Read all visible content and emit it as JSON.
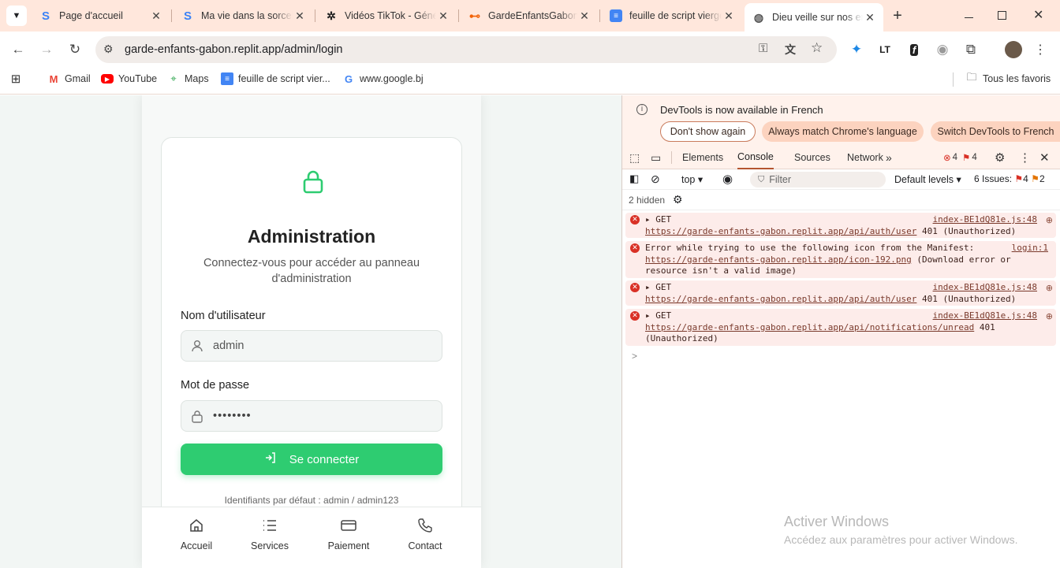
{
  "browser": {
    "tabs": [
      {
        "title": "Page d'accueil",
        "icon": "replit-icon"
      },
      {
        "title": "Ma vie dans la sorcellerie",
        "icon": "replit-icon"
      },
      {
        "title": "Vidéos TikTok - Générateur",
        "icon": "openai-icon"
      },
      {
        "title": "GardeEnfantsGabon",
        "icon": "replit-orange-icon"
      },
      {
        "title": "feuille de script vierge",
        "icon": "google-docs-icon"
      },
      {
        "title": "Dieu veille sur nos enfants",
        "icon": "globe-icon",
        "active": true
      }
    ],
    "new_tab": "+",
    "url": "garde-enfants-gabon.replit.app/admin/login",
    "bookmarks": [
      {
        "label": "Gmail",
        "icon": "gmail-icon"
      },
      {
        "label": "YouTube",
        "icon": "youtube-icon"
      },
      {
        "label": "Maps",
        "icon": "maps-icon"
      },
      {
        "label": "feuille de script vier...",
        "icon": "google-docs-icon"
      },
      {
        "label": "www.google.bj",
        "icon": "google-icon"
      }
    ],
    "all_bookmarks": "Tous les favoris"
  },
  "login": {
    "title": "Administration",
    "subtitle": "Connectez-vous pour accéder au panneau d'administration",
    "username_label": "Nom d'utilisateur",
    "username_value": "admin",
    "password_label": "Mot de passe",
    "password_value": "••••••••",
    "submit": "Se connecter",
    "hint": "Identifiants par défaut : admin / admin123"
  },
  "bottom_nav": [
    {
      "label": "Accueil",
      "icon": "home-icon"
    },
    {
      "label": "Services",
      "icon": "list-icon"
    },
    {
      "label": "Paiement",
      "icon": "credit-card-icon"
    },
    {
      "label": "Contact",
      "icon": "phone-icon"
    }
  ],
  "devtools": {
    "info_text": "DevTools is now available in French",
    "btn_dont_show": "Don't show again",
    "btn_match": "Always match Chrome's language",
    "btn_switch": "Switch DevTools to French",
    "tabs": [
      "Elements",
      "Console",
      "Sources",
      "Network"
    ],
    "active_tab": "Console",
    "error_count": "4",
    "warning_count": "4",
    "context": "top",
    "filter_placeholder": "Filter",
    "levels": "Default levels",
    "issues_label": "6 Issues:",
    "issues_errors": "4",
    "issues_warnings": "2",
    "hidden": "2 hidden",
    "messages": [
      {
        "type": "GET",
        "source": "index-BE1dQ81e.js:48",
        "url": "https://garde-enfants-gabon.replit.app/api/auth/user",
        "status": "401 (Unauthorized)"
      },
      {
        "type": "Error while trying to use the following icon from the Manifest:",
        "source": "login:1",
        "url": "https://garde-enfants-gabon.replit.app/icon-192.png",
        "status": "(Download error or resource isn't a valid image)"
      },
      {
        "type": "GET",
        "source": "index-BE1dQ81e.js:48",
        "url": "https://garde-enfants-gabon.replit.app/api/auth/user",
        "status": "401 (Unauthorized)"
      },
      {
        "type": "GET",
        "source": "index-BE1dQ81e.js:48",
        "url": "https://garde-enfants-gabon.replit.app/api/notifications/unread",
        "status": "401 (Unauthorized)"
      }
    ],
    "prompt": ">"
  },
  "watermark": {
    "title": "Activer Windows",
    "text": "Accédez aux paramètres pour activer Windows."
  },
  "colors": {
    "accent_green": "#2ecc71",
    "tab_strip": "#ffe7dc",
    "error": "#d93025"
  }
}
